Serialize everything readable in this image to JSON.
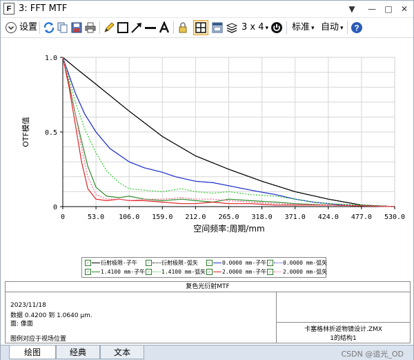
{
  "window": {
    "title": "3: FFT MTF",
    "app_icon_letter": "F"
  },
  "window_controls": {
    "pin": "▼",
    "minimize": "—",
    "maximize": "□",
    "close": "✕"
  },
  "toolbar": {
    "settings_label": "设置",
    "fields_label": "3 x 4",
    "standard_label": "标准",
    "auto_label": "自动",
    "dropdown_glyph": "▾"
  },
  "chart_data": {
    "type": "line",
    "xlabel": "空间频率:周期/mm",
    "ylabel": "OTF模值",
    "xlim": [
      0,
      530
    ],
    "ylim": [
      0,
      1
    ],
    "x_ticks": [
      "0",
      "53.0",
      "106.0",
      "159.0",
      "212.0",
      "265.0",
      "318.0",
      "371.0",
      "424.0",
      "477.0",
      "530.0"
    ],
    "y_ticks": [
      "0",
      "0.5",
      "1.0"
    ],
    "grid": true,
    "series": [
      {
        "name": "衍射极限-子午",
        "color": "#000000",
        "dash": "none",
        "x": [
          0,
          20,
          53,
          106,
          159,
          212,
          265,
          318,
          371,
          424,
          477,
          530
        ],
        "y": [
          1.0,
          0.93,
          0.82,
          0.64,
          0.47,
          0.34,
          0.25,
          0.17,
          0.1,
          0.05,
          0.01,
          0
        ]
      },
      {
        "name": "衍射极限-弧矢",
        "color": "#000000",
        "dash": "2,2",
        "x": [
          0,
          20,
          53,
          106,
          159,
          212,
          265,
          318,
          371,
          424,
          477,
          530
        ],
        "y": [
          1.0,
          0.93,
          0.82,
          0.64,
          0.47,
          0.34,
          0.25,
          0.17,
          0.1,
          0.05,
          0.01,
          0
        ]
      },
      {
        "name": "0.0000 mm-子午",
        "color": "#2233cc",
        "dash": "none",
        "x": [
          0,
          10,
          20,
          35,
          53,
          75,
          106,
          130,
          159,
          180,
          212,
          240,
          265,
          300,
          340,
          371,
          400,
          424,
          450,
          477,
          530
        ],
        "y": [
          1.0,
          0.88,
          0.76,
          0.62,
          0.5,
          0.39,
          0.3,
          0.26,
          0.23,
          0.2,
          0.17,
          0.16,
          0.14,
          0.11,
          0.08,
          0.05,
          0.03,
          0.02,
          0.01,
          0.005,
          0
        ]
      },
      {
        "name": "0.0000 mm-弧矢",
        "color": "#2233cc",
        "dash": "2,2",
        "x": [
          0,
          10,
          20,
          35,
          53,
          75,
          106,
          130,
          159,
          180,
          212,
          240,
          265,
          300,
          340,
          371,
          400,
          424,
          450,
          477,
          530
        ],
        "y": [
          1.0,
          0.88,
          0.76,
          0.62,
          0.5,
          0.39,
          0.3,
          0.26,
          0.23,
          0.2,
          0.17,
          0.16,
          0.14,
          0.11,
          0.08,
          0.05,
          0.03,
          0.02,
          0.01,
          0.005,
          0
        ]
      },
      {
        "name": "1.4100 mm-子午",
        "color": "#2e8b2e",
        "dash": "none",
        "x": [
          0,
          10,
          20,
          30,
          40,
          53,
          70,
          90,
          106,
          130,
          159,
          190,
          212,
          240,
          265,
          300,
          340,
          371,
          424,
          477,
          530
        ],
        "y": [
          1.0,
          0.82,
          0.62,
          0.44,
          0.27,
          0.13,
          0.07,
          0.06,
          0.07,
          0.05,
          0.04,
          0.05,
          0.04,
          0.03,
          0.05,
          0.04,
          0.03,
          0.02,
          0.01,
          0.005,
          0
        ]
      },
      {
        "name": "1.4100 mm-弧矢",
        "color": "#2ecc2e",
        "dash": "2,2",
        "x": [
          0,
          10,
          20,
          35,
          53,
          70,
          90,
          106,
          130,
          159,
          190,
          212,
          240,
          265,
          300,
          340,
          371,
          400,
          424,
          477,
          530
        ],
        "y": [
          1.0,
          0.86,
          0.7,
          0.52,
          0.36,
          0.24,
          0.16,
          0.12,
          0.11,
          0.1,
          0.12,
          0.1,
          0.09,
          0.1,
          0.08,
          0.07,
          0.05,
          0.03,
          0.02,
          0.01,
          0
        ]
      },
      {
        "name": "2.0000 mm-子午",
        "color": "#dd2222",
        "dash": "none",
        "x": [
          0,
          10,
          20,
          30,
          40,
          53,
          70,
          90,
          106,
          130,
          159,
          190,
          212,
          240,
          265,
          300,
          340,
          371,
          424,
          477,
          530
        ],
        "y": [
          1.0,
          0.8,
          0.55,
          0.3,
          0.12,
          0.05,
          0.04,
          0.05,
          0.04,
          0.04,
          0.03,
          0.02,
          0.02,
          0.03,
          0.02,
          0.02,
          0.01,
          0.01,
          0.01,
          0.005,
          0
        ]
      },
      {
        "name": "2.0000 mm-弧矢",
        "color": "#ff6688",
        "dash": "2,2",
        "x": [
          0,
          10,
          20,
          30,
          40,
          53,
          70,
          90,
          106,
          130,
          159,
          190,
          212,
          240,
          265,
          300,
          340,
          371,
          424,
          477,
          530
        ],
        "y": [
          1.0,
          0.84,
          0.62,
          0.4,
          0.2,
          0.08,
          0.05,
          0.05,
          0.04,
          0.05,
          0.05,
          0.06,
          0.05,
          0.05,
          0.04,
          0.03,
          0.02,
          0.015,
          0.01,
          0.005,
          0
        ]
      }
    ]
  },
  "info": {
    "title": "复色光衍射MTF",
    "date": "2023/11/18",
    "data_line": "数据 0.4200 到 1.0640 μm.",
    "surface_line": "面: 像面",
    "legend_note": "图例对应于视场位置",
    "filename": "卡塞格林折返物镜设计.ZMX",
    "config": "1的结构1"
  },
  "tabs": [
    "绘图",
    "经典",
    "文本"
  ],
  "watermark": "CSDN @追光_OD"
}
